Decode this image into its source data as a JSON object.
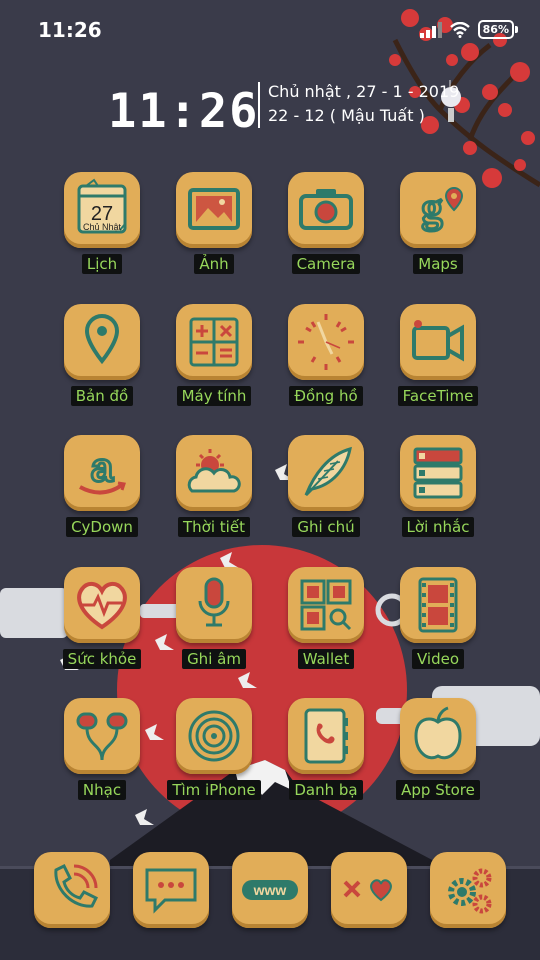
{
  "status_bar": {
    "time": "11:26",
    "battery": "86%"
  },
  "widget": {
    "clock": "11:26",
    "date_line1": "Chủ nhật , 27 - 1 - 2019",
    "date_line2": "22 - 12 ( Mậu Tuất )"
  },
  "calendar_icon": {
    "day": "27",
    "weekday": "Chủ Nhật"
  },
  "apps": [
    {
      "label": "Lịch",
      "icon": "calendar-icon"
    },
    {
      "label": "Ảnh",
      "icon": "photos-icon"
    },
    {
      "label": "Camera",
      "icon": "camera-icon"
    },
    {
      "label": "Maps",
      "icon": "maps-icon"
    },
    {
      "label": "Bản đồ",
      "icon": "map-pin-icon"
    },
    {
      "label": "Máy tính",
      "icon": "calculator-icon"
    },
    {
      "label": "Đồng hồ",
      "icon": "clock-icon"
    },
    {
      "label": "FaceTime",
      "icon": "video-camera-icon"
    },
    {
      "label": "CyDown",
      "icon": "amazon-icon"
    },
    {
      "label": "Thời tiết",
      "icon": "weather-icon"
    },
    {
      "label": "Ghi chú",
      "icon": "feather-icon"
    },
    {
      "label": "Lời nhắc",
      "icon": "reminders-icon"
    },
    {
      "label": "Sức khỏe",
      "icon": "heart-icon"
    },
    {
      "label": "Ghi âm",
      "icon": "microphone-icon"
    },
    {
      "label": "Wallet",
      "icon": "wallet-icon"
    },
    {
      "label": "Video",
      "icon": "film-icon"
    },
    {
      "label": "Nhạc",
      "icon": "earphones-icon"
    },
    {
      "label": "Tìm iPhone",
      "icon": "radar-icon"
    },
    {
      "label": "Danh bạ",
      "icon": "contacts-icon"
    },
    {
      "label": "App Store",
      "icon": "apple-icon"
    }
  ],
  "dock": [
    {
      "name": "phone",
      "icon": "phone-icon"
    },
    {
      "name": "messages",
      "icon": "message-bubble-icon"
    },
    {
      "name": "safari",
      "icon": "www-icon"
    },
    {
      "name": "games",
      "icon": "x-heart-icon"
    },
    {
      "name": "settings",
      "icon": "gears-icon"
    }
  ],
  "colors": {
    "background": "#3a3b4a",
    "icon_fill": "#e1ad58",
    "icon_stroke": "#2e7a6a",
    "icon_accent": "#c9473d",
    "label_bg": "#0f1111",
    "label_text": "#97d75b",
    "sun": "#c8373a",
    "blossom": "#d63a3a"
  }
}
